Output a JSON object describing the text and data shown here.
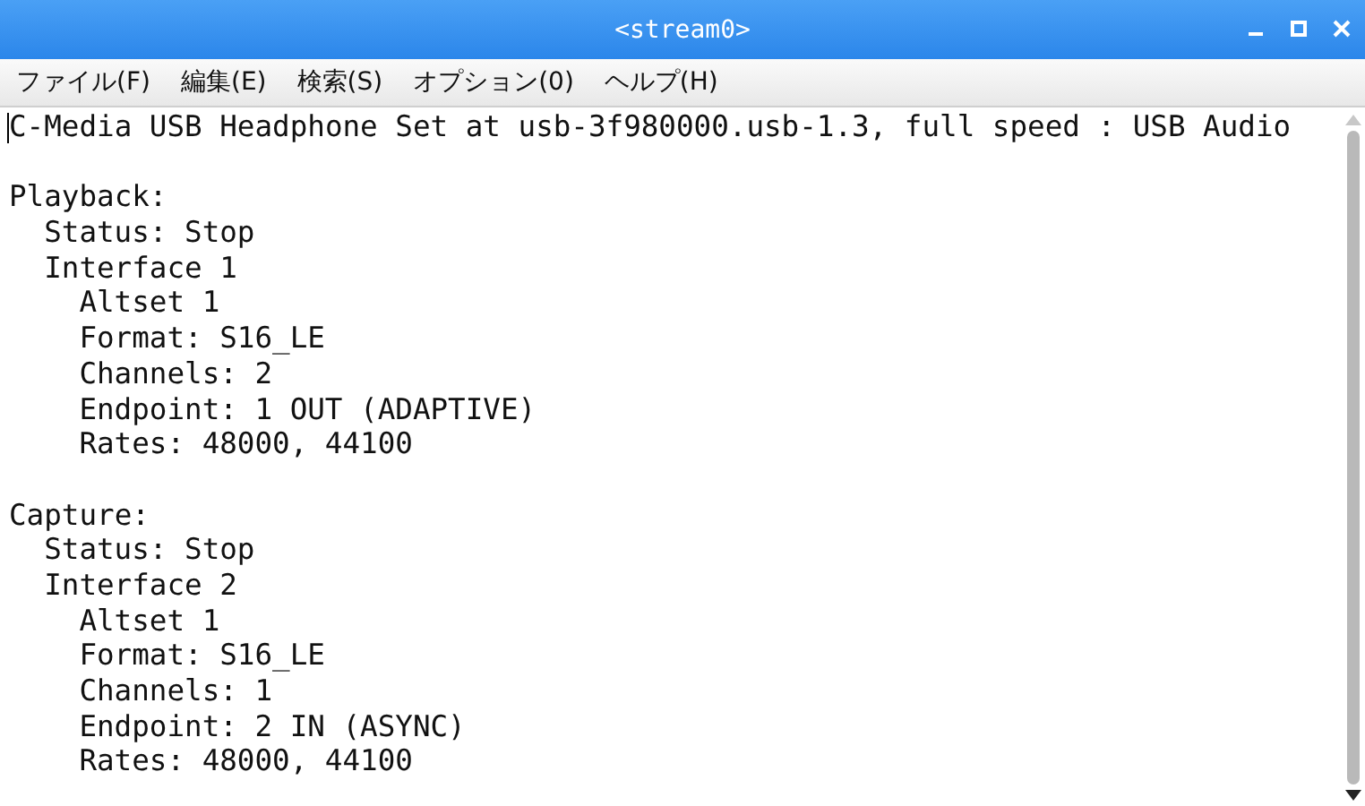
{
  "window": {
    "title": "<stream0>"
  },
  "menu": [
    "ファイル(F)",
    "編集(E)",
    "検索(S)",
    "オプション(0)",
    "ヘルプ(H)"
  ],
  "document": {
    "header": "C-Media USB Headphone Set at usb-3f980000.usb-1.3, full speed : USB Audio",
    "sections": [
      {
        "text": "Playback:",
        "children": [
          {
            "text": "Status: Stop"
          },
          {
            "text": "Interface 1",
            "children": [
              {
                "text": "Altset 1"
              },
              {
                "text": "Format: S16_LE"
              },
              {
                "text": "Channels: 2"
              },
              {
                "text": "Endpoint: 1 OUT (ADAPTIVE)"
              },
              {
                "text": "Rates: 48000, 44100"
              }
            ]
          }
        ]
      },
      {
        "text": "Capture:",
        "children": [
          {
            "text": "Status: Stop"
          },
          {
            "text": "Interface 2",
            "children": [
              {
                "text": "Altset 1"
              },
              {
                "text": "Format: S16_LE"
              },
              {
                "text": "Channels: 1"
              },
              {
                "text": "Endpoint: 2 IN (ASYNC)"
              },
              {
                "text": "Rates: 48000, 44100"
              }
            ]
          }
        ]
      }
    ]
  }
}
